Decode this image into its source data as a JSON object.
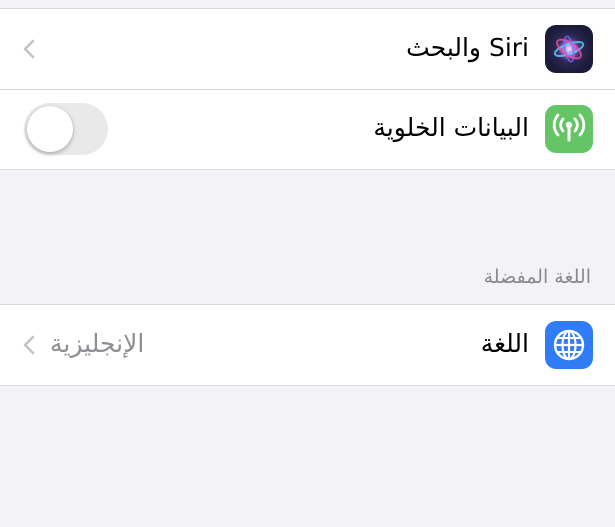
{
  "rows_top": [
    {
      "label": "Siri والبحث",
      "icon": "siri-icon",
      "accessory": "chevron"
    },
    {
      "label": "البيانات الخلوية",
      "icon": "cellular-antenna-icon",
      "accessory": "toggle",
      "toggle_on": false
    }
  ],
  "preferred_language": {
    "section_header": "اللغة المفضلة",
    "row": {
      "label": "اللغة",
      "value": "الإنجليزية",
      "icon": "globe-icon",
      "accessory": "chevron"
    }
  },
  "colors": {
    "background": "#f2f2f7",
    "cellular_icon": "#65c466",
    "language_icon": "#2f7cf6",
    "siri_icon_bg": "#1c1b3a",
    "toggle_off": "#e9e9ea"
  }
}
